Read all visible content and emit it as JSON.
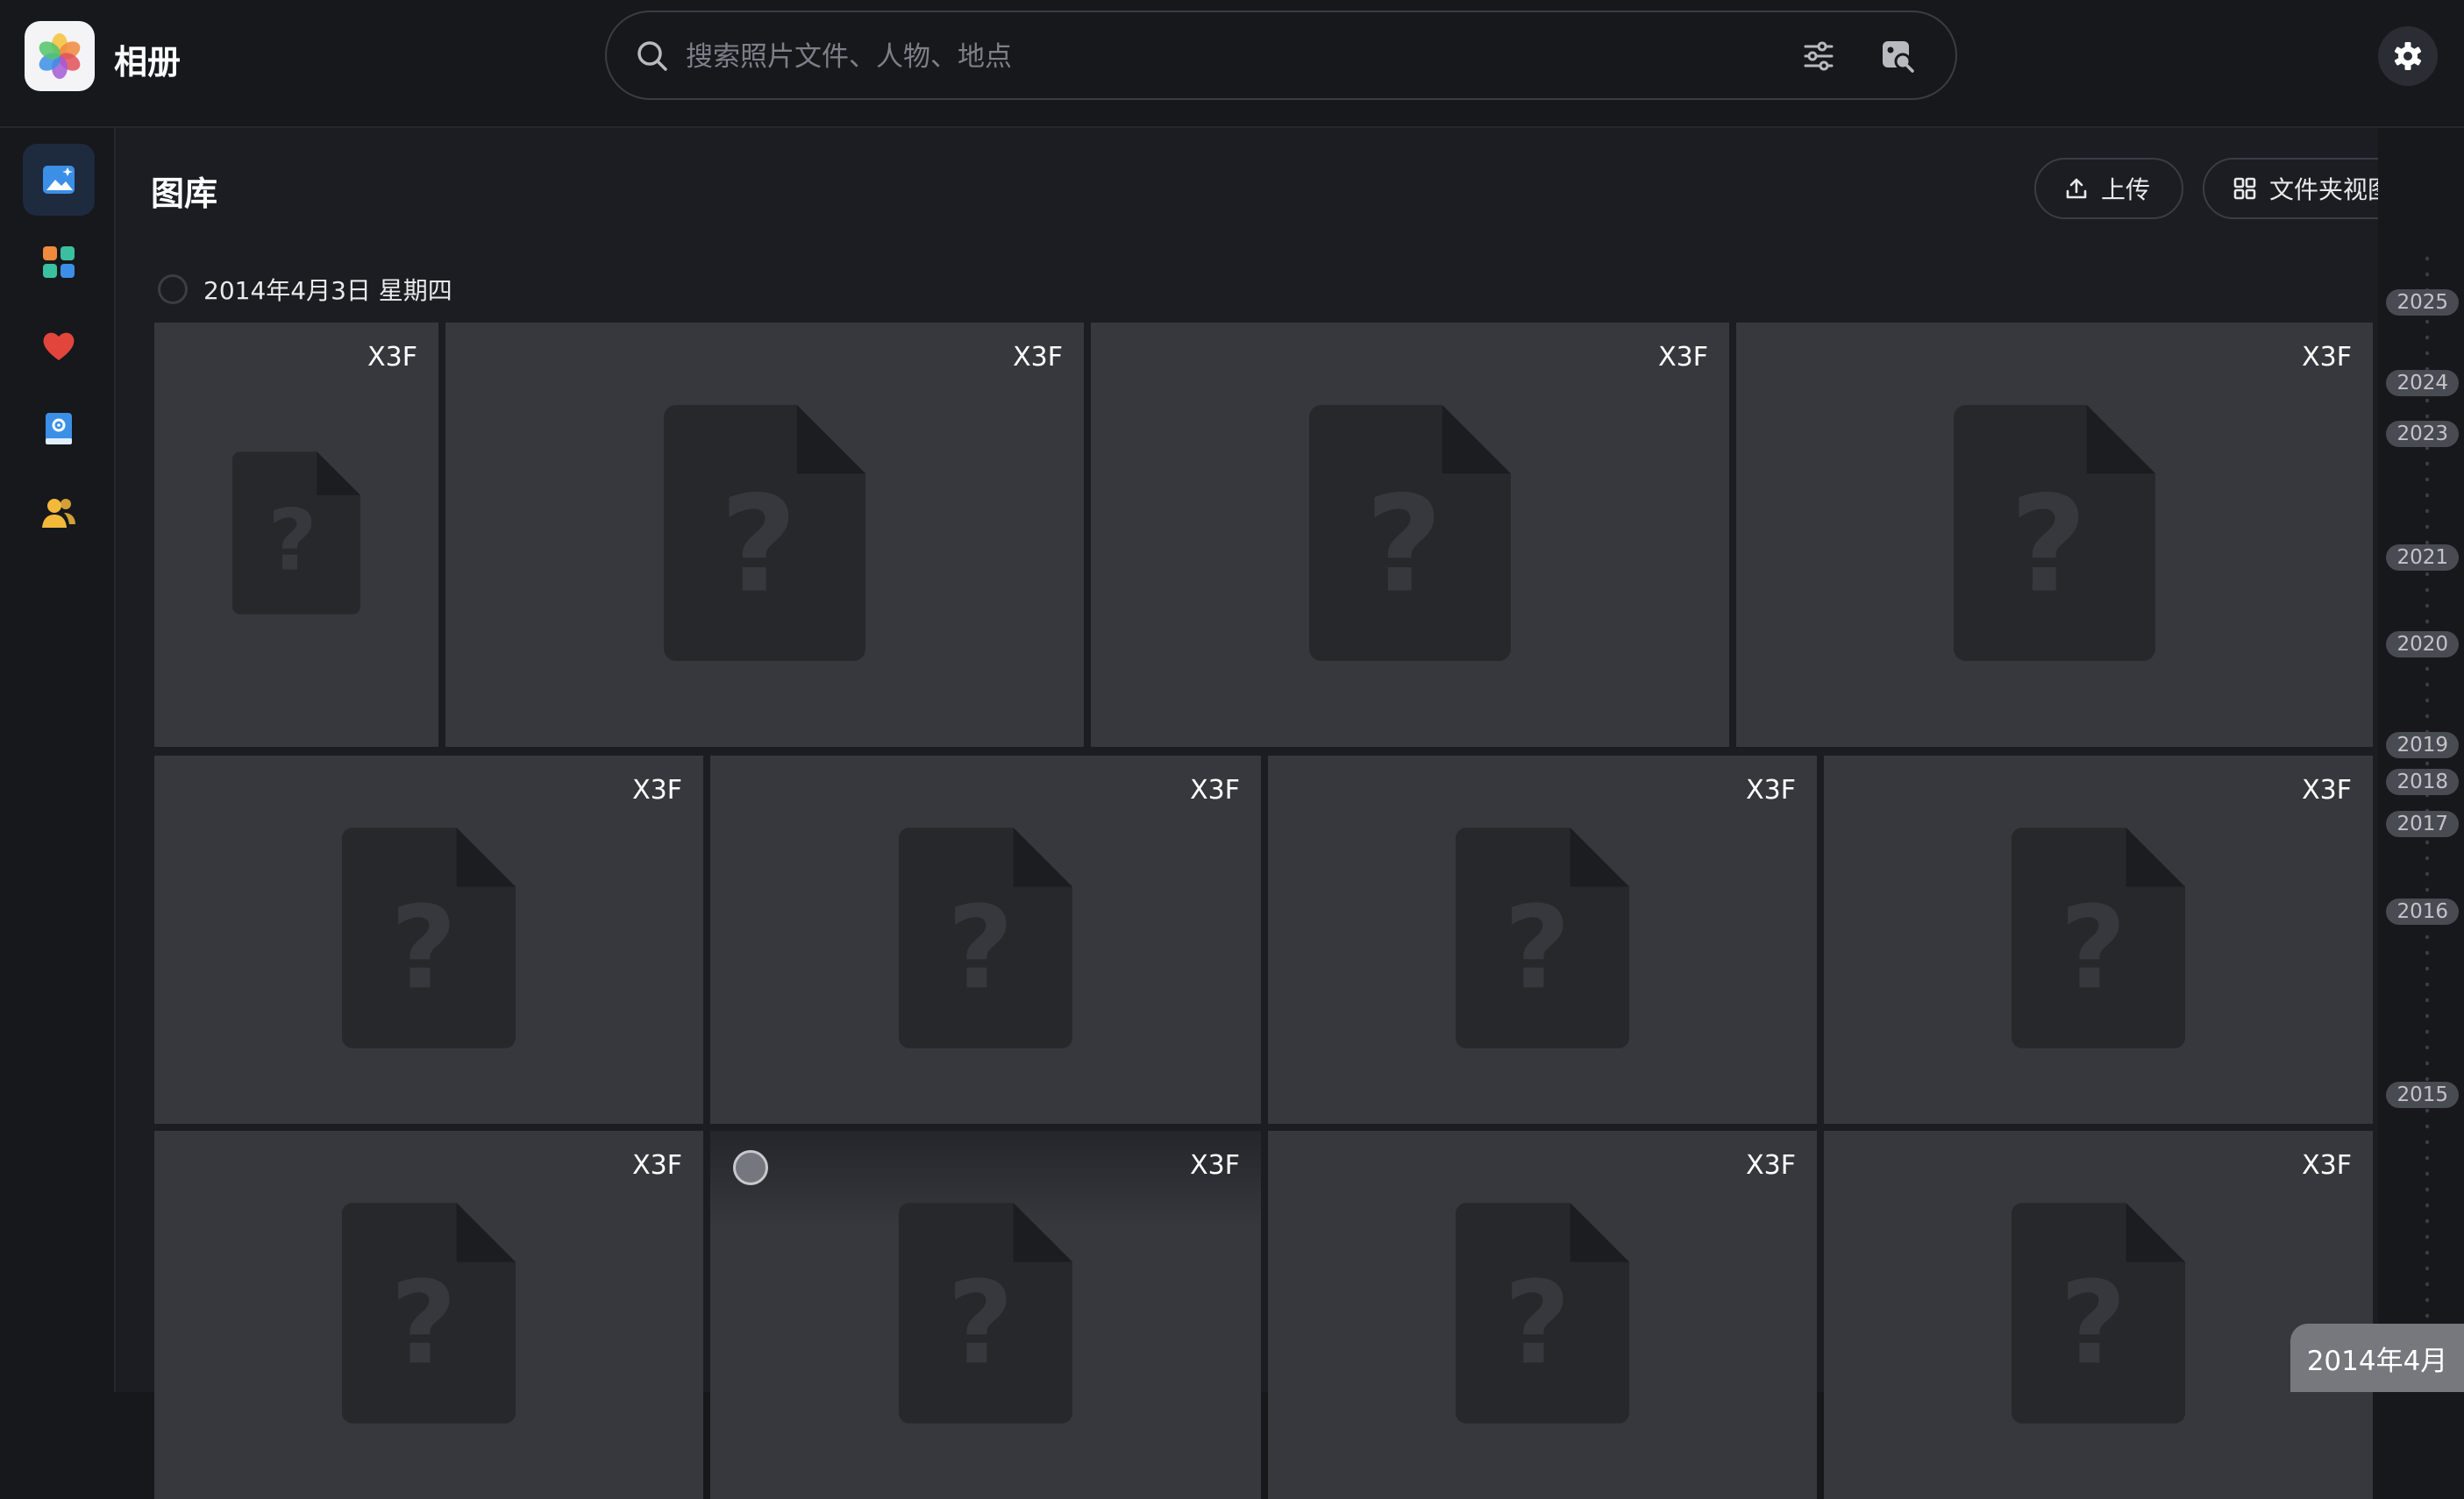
{
  "app": {
    "title": "相册"
  },
  "search": {
    "placeholder": "搜索照片文件、人物、地点",
    "value": ""
  },
  "sidebar": {
    "items": [
      {
        "name": "library",
        "icon": "photo-library-icon",
        "active": true
      },
      {
        "name": "albums",
        "icon": "albums-icon",
        "active": false
      },
      {
        "name": "favorites",
        "icon": "heart-icon",
        "active": false
      },
      {
        "name": "storage",
        "icon": "disk-icon",
        "active": false
      },
      {
        "name": "people",
        "icon": "people-icon",
        "active": false
      }
    ]
  },
  "main": {
    "title": "图库",
    "upload_label": "上传",
    "folder_view_label": "文件夹视图",
    "date_group": "2014年4月3日 星期四"
  },
  "tiles": [
    {
      "format": "X3F"
    },
    {
      "format": "X3F"
    },
    {
      "format": "X3F"
    },
    {
      "format": "X3F"
    },
    {
      "format": "X3F"
    },
    {
      "format": "X3F"
    },
    {
      "format": "X3F"
    },
    {
      "format": "X3F"
    },
    {
      "format": "X3F"
    },
    {
      "format": "X3F"
    },
    {
      "format": "X3F"
    },
    {
      "format": "X3F"
    }
  ],
  "timeline": {
    "years": [
      "2025",
      "2024",
      "2023",
      "2021",
      "2020",
      "2019",
      "2018",
      "2017",
      "2016",
      "2015"
    ],
    "current_month": "2014年4月"
  },
  "colors": {
    "accent": "#3b8fe6",
    "background": "#1b1d22",
    "tile": "#36383d"
  }
}
